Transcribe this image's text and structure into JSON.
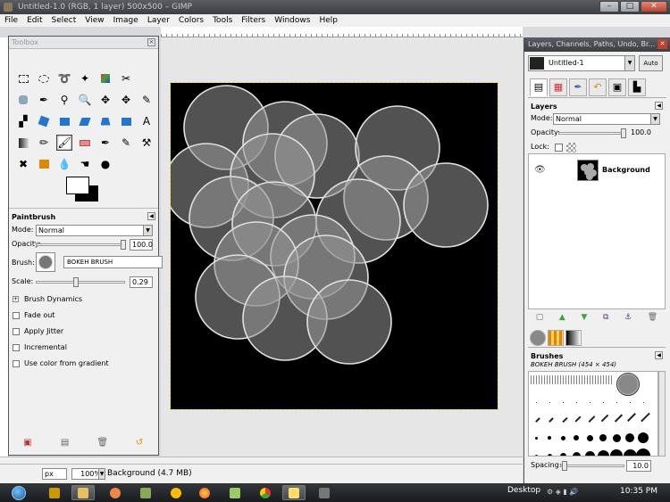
{
  "window": {
    "title": "Untitled-1.0 (RGB, 1 layer) 500x500 – GIMP",
    "minimize": "–",
    "maximize": "□",
    "close": "✕"
  },
  "menu": [
    "File",
    "Edit",
    "Select",
    "View",
    "Image",
    "Layer",
    "Colors",
    "Tools",
    "Filters",
    "Windows",
    "Help"
  ],
  "toolbox": {
    "title": "Toolbox",
    "active_tool": "paintbrush",
    "tool_options": {
      "title": "Paintbrush",
      "mode_label": "Mode:",
      "mode_value": "Normal",
      "opacity_label": "Opacity:",
      "opacity_value": "100.0",
      "opacity_fraction": 1.0,
      "brush_label": "Brush:",
      "brush_name": "BOKEH BRUSH",
      "scale_label": "Scale:",
      "scale_value": "0.29",
      "scale_fraction": 0.29,
      "brush_dynamics": "Brush Dynamics",
      "checkboxes": [
        "Fade out",
        "Apply Jitter",
        "Incremental",
        "Use color from gradient"
      ]
    }
  },
  "statusbar": {
    "unit": "px",
    "zoom": "100%",
    "layer_info": "Background (4.7 MB)"
  },
  "dock": {
    "title": "Layers, Channels, Paths, Undo, Br...",
    "image_name": "Untitled-1",
    "auto_label": "Auto",
    "layers": {
      "title": "Layers",
      "mode_label": "Mode:",
      "mode_value": "Normal",
      "opacity_label": "Opacity:",
      "opacity_value": "100.0",
      "lock_label": "Lock:",
      "items": [
        {
          "name": "Background",
          "visible": true
        }
      ]
    },
    "brushes": {
      "title": "Brushes",
      "selected": "BOKEH BRUSH (454 × 454)",
      "spacing_label": "Spacing:",
      "spacing_value": "10.0"
    }
  },
  "taskbar": {
    "desktop_label": "Desktop",
    "clock": "10:35 PM"
  },
  "colors": {
    "canvas_bg": "#000000",
    "bokeh_fill": "rgba(150,150,150,0.55)",
    "bokeh_stroke": "#e0e0e0"
  }
}
